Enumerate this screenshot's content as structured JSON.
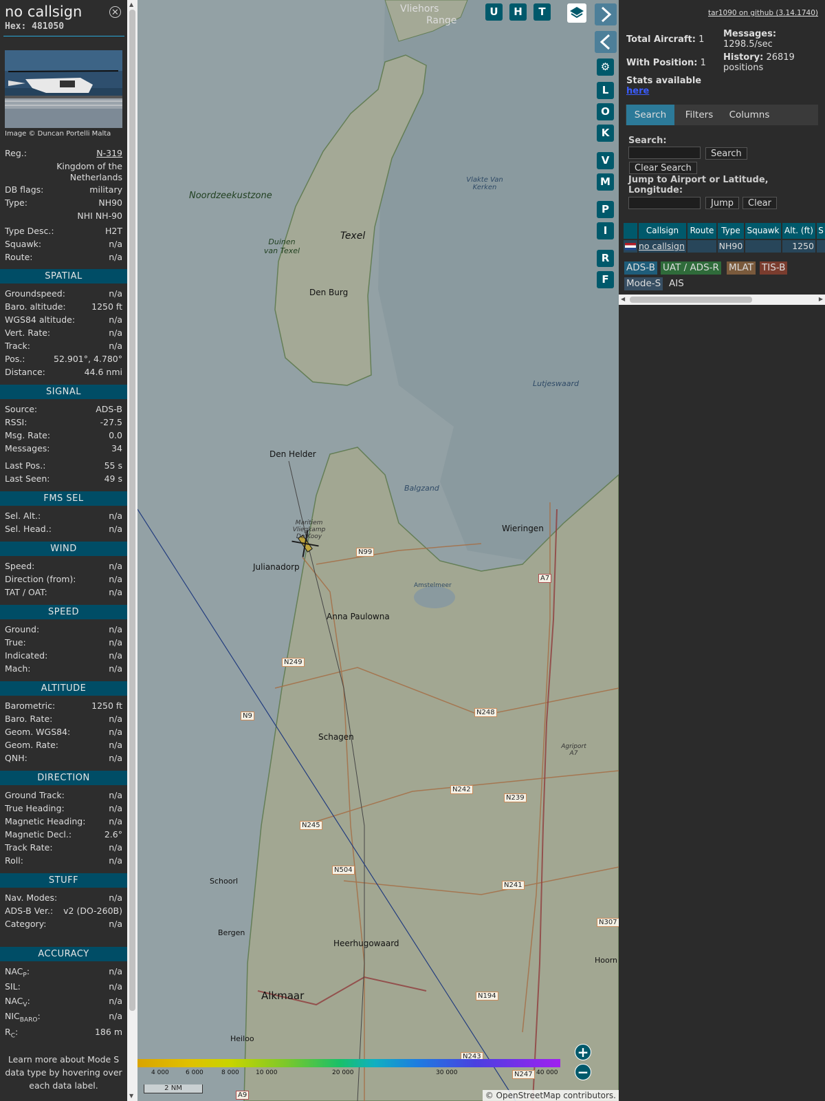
{
  "aircraft": {
    "callsign": "no callsign",
    "hex_label": "Hex: 481050",
    "photo_credit": "Image © Duncan Portelli Malta",
    "reg_label": "Reg.:",
    "reg": "N-319",
    "country": "Kingdom of the Netherlands",
    "dbflags_label": "DB flags:",
    "dbflags": "military",
    "type_label": "Type:",
    "type": "NH90",
    "type_full": "NHI NH-90",
    "typedesc_label": "Type Desc.:",
    "typedesc": "H2T",
    "squawk_label": "Squawk:",
    "squawk": "n/a",
    "route_label": "Route:",
    "route": "n/a"
  },
  "sections": {
    "spatial": "SPATIAL",
    "signal": "SIGNAL",
    "fms": "FMS SEL",
    "wind": "WIND",
    "speed": "SPEED",
    "altitude": "ALTITUDE",
    "direction": "DIRECTION",
    "stuff": "STUFF",
    "accuracy": "ACCURACY"
  },
  "spatial": [
    {
      "k": "Groundspeed:",
      "v": "n/a"
    },
    {
      "k": "Baro. altitude:",
      "v": "1250 ft"
    },
    {
      "k": "WGS84 altitude:",
      "v": "n/a"
    },
    {
      "k": "Vert. Rate:",
      "v": "n/a"
    },
    {
      "k": "Track:",
      "v": "n/a"
    },
    {
      "k": "Pos.:",
      "v": "52.901°, 4.780°"
    },
    {
      "k": "Distance:",
      "v": "44.6 nmi"
    }
  ],
  "signal": [
    {
      "k": "Source:",
      "v": "ADS-B"
    },
    {
      "k": "RSSI:",
      "v": "-27.5"
    },
    {
      "k": "Msg. Rate:",
      "v": "0.0"
    },
    {
      "k": "Messages:",
      "v": "34"
    },
    {
      "k": "Last Pos.:",
      "v": "55 s"
    },
    {
      "k": "Last Seen:",
      "v": "49 s"
    }
  ],
  "fms": [
    {
      "k": "Sel. Alt.:",
      "v": "n/a"
    },
    {
      "k": "Sel. Head.:",
      "v": "n/a"
    }
  ],
  "wind": [
    {
      "k": "Speed:",
      "v": "n/a"
    },
    {
      "k": "Direction (from):",
      "v": "n/a"
    },
    {
      "k": "TAT / OAT:",
      "v": "n/a"
    }
  ],
  "speed": [
    {
      "k": "Ground:",
      "v": "n/a"
    },
    {
      "k": "True:",
      "v": "n/a"
    },
    {
      "k": "Indicated:",
      "v": "n/a"
    },
    {
      "k": "Mach:",
      "v": "n/a"
    }
  ],
  "altitude": [
    {
      "k": "Barometric:",
      "v": "1250 ft"
    },
    {
      "k": "Baro. Rate:",
      "v": "n/a"
    },
    {
      "k": "Geom. WGS84:",
      "v": "n/a"
    },
    {
      "k": "Geom. Rate:",
      "v": "n/a"
    },
    {
      "k": "QNH:",
      "v": "n/a"
    }
  ],
  "direction": [
    {
      "k": "Ground Track:",
      "v": "n/a"
    },
    {
      "k": "True Heading:",
      "v": "n/a"
    },
    {
      "k": "Magnetic Heading:",
      "v": "n/a"
    },
    {
      "k": "Magnetic Decl.:",
      "v": "2.6°"
    },
    {
      "k": "Track Rate:",
      "v": "n/a"
    },
    {
      "k": "Roll:",
      "v": "n/a"
    }
  ],
  "stuff": [
    {
      "k": "Nav. Modes:",
      "v": "n/a"
    },
    {
      "k": "ADS-B Ver.:",
      "v": "v2 (DO-260B)"
    },
    {
      "k": "Category:",
      "v": "n/a"
    }
  ],
  "accuracy": {
    "nacp_main": "NAC",
    "nacp_sub": "P",
    "nacp": "n/a",
    "sil_label": "SIL:",
    "sil": "n/a",
    "nacv_main": "NAC",
    "nacv_sub": "V",
    "nacv": "n/a",
    "nic_main": "NIC",
    "nic_sub": "BARO",
    "nic": "n/a",
    "rc_main": "R",
    "rc_sub": "C",
    "rc": "186 m"
  },
  "learn_more": "Learn more about Mode S data type by hovering over each data label.",
  "map": {
    "buttons": [
      "U",
      "H",
      "T",
      "L",
      "O",
      "K",
      "V",
      "M",
      "P",
      "I",
      "R",
      "F"
    ],
    "attribution": "© OpenStreetMap contributors.",
    "scale": "2 NM",
    "alt_scale_labels": [
      "4 000",
      "6 000",
      "8 000",
      "10 000",
      "20 000",
      "30 000",
      "40 000"
    ],
    "places": [
      {
        "t": "Vliehors",
        "c": "#333"
      },
      {
        "t": "Range",
        "c": "#333"
      },
      {
        "t": "Noordzeekustzone",
        "c": "#2d5a2d"
      },
      {
        "t": "Texel",
        "c": "#222"
      },
      {
        "t": "Duinen van Texel",
        "c": "#2d5a2d"
      },
      {
        "t": "Den Burg",
        "c": "#333"
      },
      {
        "t": "Den Helder",
        "c": "#222"
      },
      {
        "t": "Julianadorp",
        "c": "#222"
      },
      {
        "t": "Anna Paulowna",
        "c": "#222"
      },
      {
        "t": "Schagen",
        "c": "#222"
      },
      {
        "t": "Schoorl",
        "c": "#222"
      },
      {
        "t": "Bergen",
        "c": "#222"
      },
      {
        "t": "Heerhugowaard",
        "c": "#222"
      },
      {
        "t": "Alkmaar",
        "c": "#111"
      },
      {
        "t": "Heiloo",
        "c": "#222"
      },
      {
        "t": "Wieringen",
        "c": "#222"
      },
      {
        "t": "Hoorn",
        "c": "#222"
      },
      {
        "t": "Balgzand",
        "c": "#3c5a78"
      },
      {
        "t": "Lutjeswaard",
        "c": "#3c5a78"
      },
      {
        "t": "Vlakte Van Kerken",
        "c": "#3c5a78"
      },
      {
        "t": "Amstelmeer",
        "c": "#3c5a78"
      },
      {
        "t": "Maritiem Vliegkamp De Kooy",
        "c": "#444"
      },
      {
        "t": "Agriport A7",
        "c": "#444"
      }
    ],
    "road_labels": [
      "N99",
      "A7",
      "N249",
      "N248",
      "N9",
      "N242",
      "N239",
      "N245",
      "N504",
      "N241",
      "N307",
      "N194",
      "N243",
      "N247",
      "A9"
    ]
  },
  "right": {
    "version": "tar1090 on github (3.14.1740)",
    "total_label": "Total Aircraft:",
    "total": "1",
    "withpos_label": "With Position:",
    "withpos": "1",
    "messages_label": "Messages:",
    "messages": "1298.5/sec",
    "history_label": "History:",
    "history": "26819 positions",
    "stats_label": "Stats available",
    "stats_link": "here",
    "tabs": [
      "Search",
      "Filters",
      "Columns"
    ],
    "search_label": "Search:",
    "search_button": "Search",
    "clear_search": "Clear Search",
    "jump_label": "Jump to Airport or Latitude, Longitude:",
    "jump_button": "Jump",
    "clear_button": "Clear",
    "columns": [
      "Callsign",
      "Route",
      "Type",
      "Squawk",
      "Alt. (ft)",
      "S"
    ],
    "row": {
      "callsign": "no callsign",
      "route": "",
      "type": "NH90",
      "squawk": "",
      "alt": "1250"
    },
    "sources": [
      {
        "label": "ADS-B",
        "color": "#1f5d7a"
      },
      {
        "label": "UAT / ADS-R",
        "color": "#2f6b3a"
      },
      {
        "label": "MLAT",
        "color": "#7a5a3c"
      },
      {
        "label": "TIS-B",
        "color": "#7a3c2e"
      },
      {
        "label": "Mode-S",
        "color": "#374e62"
      },
      {
        "label": "AIS",
        "color": "#2b2b2b"
      }
    ]
  }
}
